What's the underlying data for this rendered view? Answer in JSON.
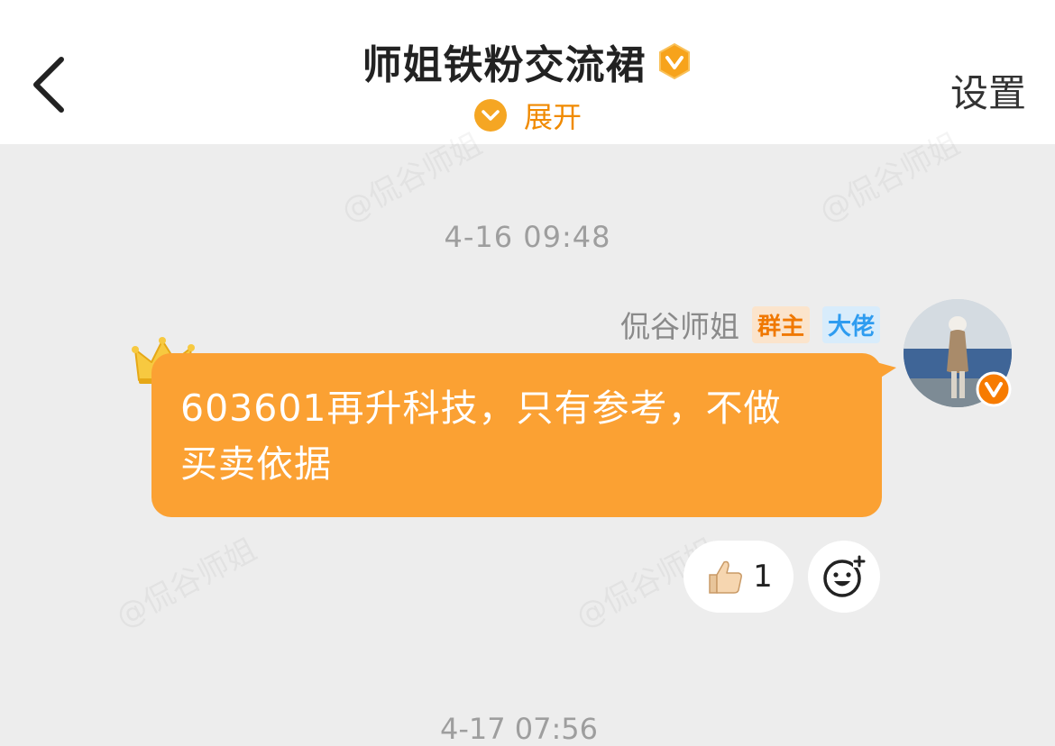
{
  "header": {
    "title": "师姐铁粉交流裙",
    "expand_label": "展开",
    "settings_label": "设置"
  },
  "watermark_text": "@侃谷师姐",
  "chat": {
    "timestamp": "4-16 09:48",
    "message": {
      "sender": "侃谷师姐",
      "tags": [
        "群主",
        "大佬"
      ],
      "text_line1": "603601再升科技，只有参考，不做",
      "text_line2": "买卖依据"
    },
    "reaction": {
      "emoji_icon": "thumbs-up-icon",
      "count": "1"
    },
    "next_timestamp_partial": "4-17 07:56"
  },
  "colors": {
    "accent": "#f08a00",
    "bubble": "#fba133",
    "background": "#ededed",
    "tag_owner": "#f07800",
    "tag_boss": "#2e9cf0"
  }
}
